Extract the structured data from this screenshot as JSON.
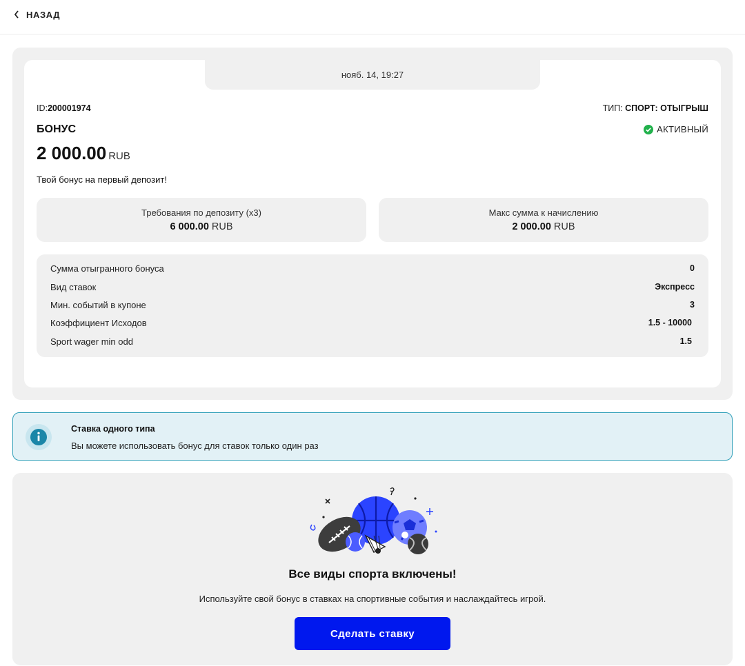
{
  "nav": {
    "back_label": "НАЗАД"
  },
  "bonus": {
    "date": "нояб. 14, 19:27",
    "id_label": "ID:",
    "id_value": "200001974",
    "type_label": "ТИП:",
    "type_value": "СПОРТ: ОТЫГРЫШ",
    "title": "БОНУС",
    "status": "АКТИВНЫЙ",
    "status_color": "#22b14c",
    "amount": "2 000.00",
    "currency": "RUB",
    "description": "Твой бонус на первый депозит!"
  },
  "requirements": [
    {
      "label": "Требования по депозиту (x3)",
      "value": "6 000.00",
      "currency": "RUB"
    },
    {
      "label": "Макс сумма к начислению",
      "value": "2 000.00",
      "currency": "RUB"
    }
  ],
  "details": [
    {
      "key": "Сумма отыгранного бонуса",
      "value": "0"
    },
    {
      "key": "Вид ставок",
      "value": "Экспресс"
    },
    {
      "key": "Мин. событий в купоне",
      "value": "3"
    },
    {
      "key": "Коэффициент Исходов",
      "value": "1.5 - 10000"
    },
    {
      "key": "Sport wager min odd",
      "value": "1.5"
    }
  ],
  "info": {
    "title": "Ставка одного типа",
    "text": "Вы можете использовать бонус для ставок только один раз",
    "accent": "#2e9eb8"
  },
  "sports": {
    "title": "Все виды спорта включены!",
    "text": "Используйте свой бонус в ставках на спортивные события и наслаждайтесь игрой.",
    "button_label": "Сделать ставку",
    "button_color": "#0018ee"
  }
}
